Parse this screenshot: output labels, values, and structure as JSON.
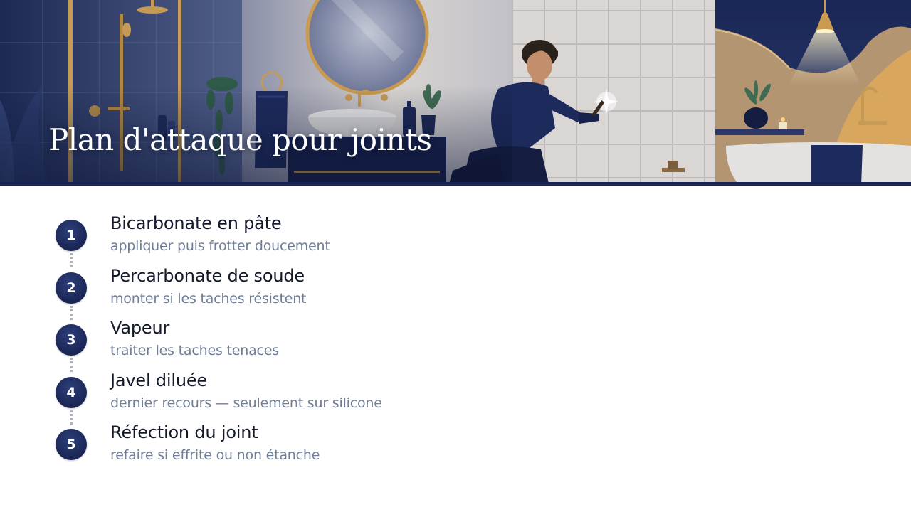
{
  "header": {
    "title": "Plan d'attaque pour joints"
  },
  "steps": [
    {
      "number": "1",
      "title": "Bicarbonate en pâte",
      "subtitle": "appliquer puis frotter doucement"
    },
    {
      "number": "2",
      "title": "Percarbonate de soude",
      "subtitle": "monter si les taches résistent"
    },
    {
      "number": "3",
      "title": "Vapeur",
      "subtitle": "traiter les taches tenaces"
    },
    {
      "number": "4",
      "title": "Javel diluée",
      "subtitle": "dernier recours — seulement sur silicone"
    },
    {
      "number": "5",
      "title": "Réfection du joint",
      "subtitle": "refaire si effrite ou non étanche"
    }
  ],
  "colors": {
    "navy": "#1a2554",
    "gold": "#c99a4f",
    "tile": "#d9d6d4",
    "subtitle": "#6f7d96"
  }
}
